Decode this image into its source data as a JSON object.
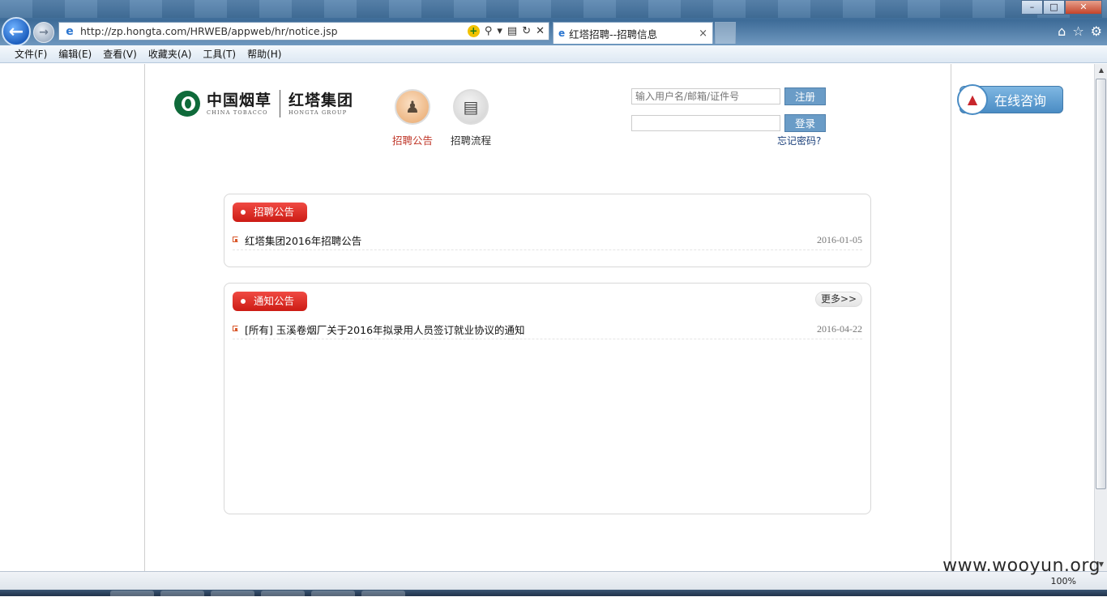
{
  "browser": {
    "url": "http://zp.hongta.com/HRWEB/appweb/hr/notice.jsp",
    "tab_title": "红塔招聘--招聘信息",
    "tab_close": "×",
    "menu": [
      "文件(F)",
      "编辑(E)",
      "查看(V)",
      "收藏夹(A)",
      "工具(T)",
      "帮助(H)"
    ],
    "zoom": "100%"
  },
  "header": {
    "logo_cn_1": "中国烟草",
    "logo_en_1": "CHINA TOBACCO",
    "logo_cn_2": "红塔集团",
    "logo_en_2": "HONGTA GROUP",
    "nav": [
      {
        "label": "招聘公告",
        "icon": "person-icon",
        "active": true
      },
      {
        "label": "招聘流程",
        "icon": "list-document-icon",
        "active": false
      }
    ]
  },
  "login": {
    "username_placeholder": "输入用户名/邮箱/证件号",
    "register_label": "注册",
    "login_label": "登录",
    "forgot_label": "忘记密码?"
  },
  "consult": {
    "label": "在线咨询"
  },
  "panels": {
    "recruit": {
      "title": "招聘公告",
      "rows": [
        {
          "text": "红塔集团2016年招聘公告",
          "date": "2016-01-05"
        }
      ]
    },
    "notice": {
      "title": "通知公告",
      "more_label": "更多>>",
      "rows": [
        {
          "text": "[所有] 玉溪卷烟厂关于2016年拟录用人员签订就业协议的通知",
          "date": "2016-04-22"
        }
      ]
    }
  },
  "watermark": "www.wooyun.org",
  "colors": {
    "tag_red": "#e0241c",
    "button_blue": "#6a9cc7",
    "active_nav_text": "#c0392b",
    "forgot_link": "#1a3f7a"
  }
}
